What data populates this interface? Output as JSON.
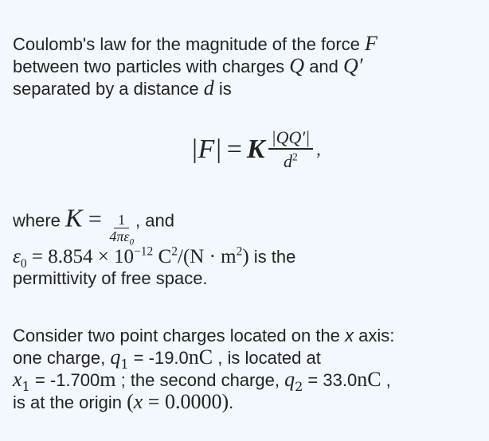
{
  "intro": {
    "line1_text": "Coulomb's law for the magnitude of the force ",
    "line1_var": "F",
    "line2_text_a": "between two particles with charges ",
    "line2_var_a": "Q",
    "line2_text_b": " and ",
    "line2_var_b": "Q′",
    "line3_text_a": "separated by a distance ",
    "line3_var": "d",
    "line3_text_b": " is"
  },
  "equation": {
    "lhs": "|F|",
    "equals": "=",
    "constant": "K",
    "numerator": "|QQ′|",
    "denominator": "d",
    "denominator_exp": "2",
    "trailing": ","
  },
  "definitions": {
    "where_text": "where ",
    "k_symbol": "K",
    "k_equals": " = ",
    "k_num": "1",
    "k_den": "4πε",
    "k_den_sub": "0",
    "and_text": ", and",
    "eps_symbol": "ε",
    "eps_sub": "0",
    "eps_value": " = 8.854 × 10",
    "eps_exp": "−12",
    "eps_unit_a": " C",
    "eps_unit_exp1": "2",
    "eps_unit_b": "/(N · m",
    "eps_unit_exp2": "2",
    "eps_unit_c": ")",
    "is_the_text": " is the",
    "line3_text": "permittivity of free space."
  },
  "problem": {
    "line1_a": "Consider two point charges located on the ",
    "line1_var": "x",
    "line1_b": " axis:",
    "line2_a": "one charge, ",
    "q1_symbol": "q",
    "q1_sub": "1",
    "q1_eq": " = -19.0",
    "q1_unit": "nC",
    "line2_b": " , is located at",
    "x1_symbol": "x",
    "x1_sub": "1",
    "x1_eq": " = -1.700",
    "x1_unit": "m",
    "line3_b": " ; the second charge, ",
    "q2_symbol": "q",
    "q2_sub": "2",
    "q2_eq": " = 33.0",
    "q2_unit": "nC",
    "line3_c": " ,",
    "line4_a": "is at the origin ",
    "origin_expr_open": "(",
    "origin_var": "x",
    "origin_eq": " = 0.0000",
    "origin_expr_close": ")",
    "line4_b": "."
  }
}
